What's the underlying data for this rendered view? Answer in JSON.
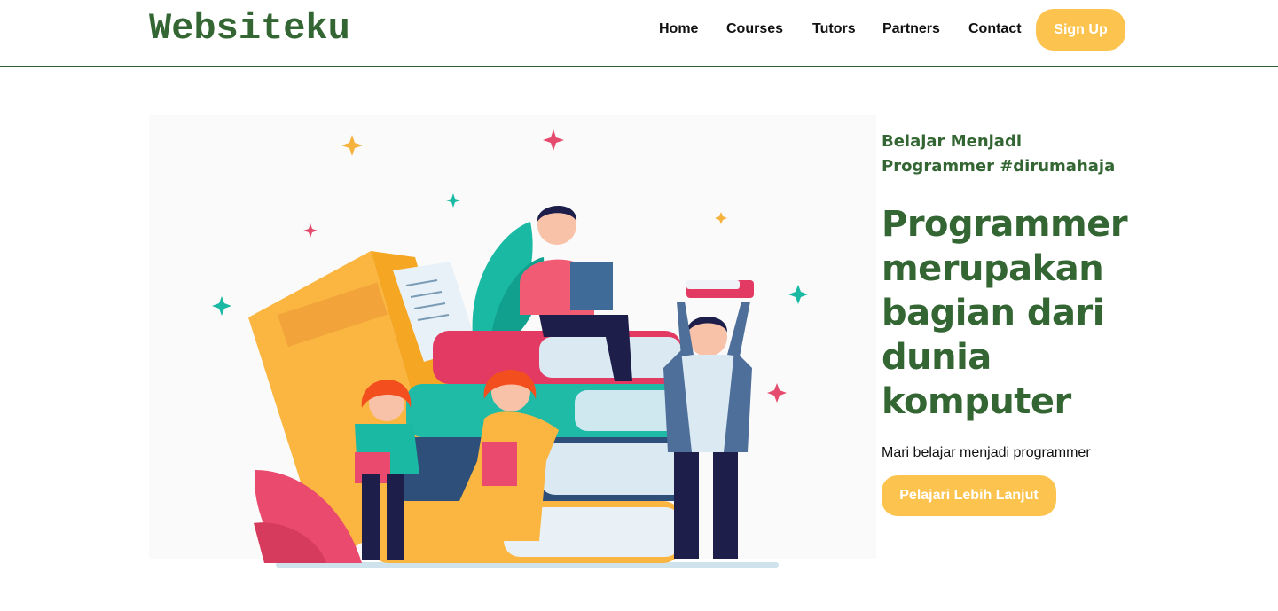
{
  "brand": {
    "logo": "Websiteku"
  },
  "nav": {
    "items": [
      "Home",
      "Courses",
      "Tutors",
      "Partners",
      "Contact"
    ],
    "signup_label": "Sign Up"
  },
  "hero": {
    "tagline_line1": "Belajar Menjadi",
    "tagline_line2": "Programmer #dirumahaja",
    "headline_lines": [
      "Programmer",
      "merupakan",
      "bagian dari",
      "dunia",
      "komputer"
    ],
    "subtext": "Mari belajar menjadi programmer",
    "cta_label": "Pelajari Lebih Lanjut"
  },
  "colors": {
    "brand_green": "#336633",
    "accent_yellow": "#fcc44f"
  }
}
